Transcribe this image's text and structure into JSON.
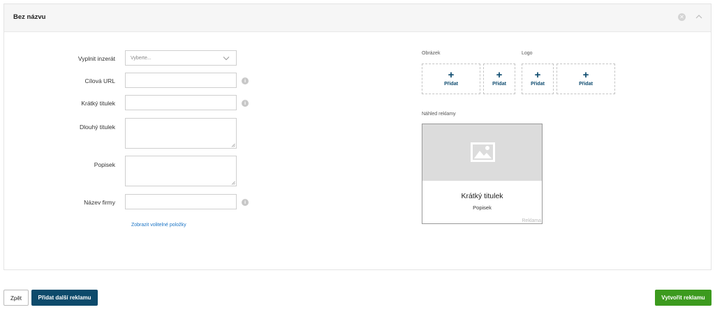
{
  "card": {
    "title": "Bez názvu",
    "close_icon": "close-circle-icon",
    "collapse_icon": "chevron-up-icon"
  },
  "form": {
    "fill_ad": {
      "label": "Vyplnit inzerát",
      "placeholder": "Vyberte..."
    },
    "target_url": {
      "label": "Cílová URL",
      "value": ""
    },
    "short_title": {
      "label": "Krátký titulek",
      "value": ""
    },
    "long_title": {
      "label": "Dlouhý titulek",
      "value": ""
    },
    "description": {
      "label": "Popisek",
      "value": ""
    },
    "company_name": {
      "label": "Název firmy",
      "value": ""
    },
    "info_glyph": "i",
    "optional_link": "Zobrazit volitelné položky"
  },
  "media": {
    "image_label": "Obrázek",
    "logo_label": "Logo",
    "plus_glyph": "+",
    "slots": [
      {
        "label": "Přidat"
      },
      {
        "label": "Přidat"
      },
      {
        "label": "Přidat"
      },
      {
        "label": "Přidat"
      }
    ]
  },
  "preview": {
    "section_label": "Náhled reklamy",
    "title": "Krátký titulek",
    "description": "Popisek",
    "ad_tag": "Reklama",
    "placeholder_icon": "image-placeholder-icon"
  },
  "actions": {
    "back": "Zpět",
    "add_another": "Přidat další reklamu",
    "create": "Vytvořit reklamu"
  },
  "colors": {
    "accent": "#0d4a6b",
    "success": "#3c9a1e",
    "link": "#1b74c5"
  }
}
